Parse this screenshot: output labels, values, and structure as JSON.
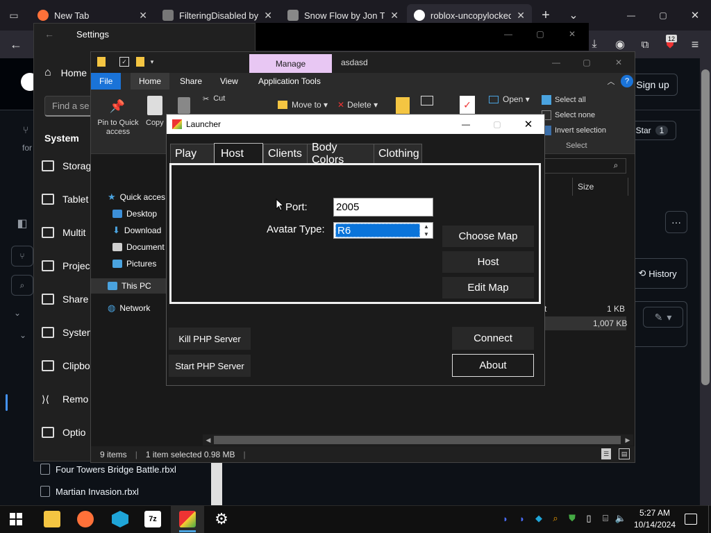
{
  "browser": {
    "tabs": [
      {
        "title": "New Tab",
        "color": "#ff7139"
      },
      {
        "title": "FilteringDisabled by be",
        "color": "#777777"
      },
      {
        "title": "Snow Flow by Jon Topi",
        "color": "#888888"
      },
      {
        "title": "roblox-uncopylocked-",
        "color": "#ffffff"
      }
    ],
    "new_tab": "+",
    "tab_list": "⌄",
    "minimize": "—",
    "maximize": "▢",
    "close": "✕",
    "notification_count": "12"
  },
  "settings": {
    "title": "Settings",
    "back": "←",
    "home": "Home",
    "search_placeholder": "Find a se",
    "section": "System",
    "items": [
      "Storag",
      "Tablet",
      "Multit",
      "Projec",
      "Share",
      "Systen",
      "Clipbo",
      "Remo",
      "Optio"
    ]
  },
  "github": {
    "sign_up": "Sign up",
    "star": "Star",
    "star_count": "1",
    "history": "History",
    "more": "···",
    "col_size": "Size",
    "file_size_1": "1 KB",
    "file_size_2": "1,007 KB",
    "file_frag": "t",
    "fork_frag": "for",
    "files_below": [
      "Four Towers Bridge Battle.rbxl",
      "Martian Invasion.rbxl"
    ]
  },
  "explorer": {
    "manage": "Manage",
    "window_title": "asdasd",
    "ribbon_tabs": [
      "File",
      "Home",
      "Share",
      "View",
      "Application Tools"
    ],
    "ribbon": {
      "pin": "Pin to Quick access",
      "copy": "Copy",
      "cut": "Cut",
      "move_to": "Move to ▾",
      "delete": "Delete ▾",
      "open": "Open ▾",
      "select_all": "Select all",
      "select_none": "Select none",
      "invert": "Invert selection",
      "select_group": "Select"
    },
    "nav": [
      "Quick acces",
      "Desktop",
      "Download",
      "Document",
      "Pictures",
      "This PC",
      "Network"
    ],
    "nav_colors": [
      "#4aa3df",
      "#3c8fd8",
      "#4aa3df",
      "#cfcfcf",
      "#4aa3df",
      "#4aa3df",
      "#4aa3df"
    ],
    "status": [
      "9 items",
      "1 item selected  0.98 MB"
    ]
  },
  "launcher": {
    "title": "Launcher",
    "tabs": [
      "Play",
      "Host",
      "Clients",
      "Body Colors",
      "Clothing"
    ],
    "port_label": "Port:",
    "port_value": "2005",
    "avatar_label": "Avatar Type:",
    "avatar_value": "R6",
    "choose_map": "Choose Map",
    "host": "Host",
    "edit_map": "Edit Map",
    "kill_php": "Kill PHP Server",
    "start_php": "Start PHP Server",
    "connect": "Connect",
    "about": "About"
  },
  "taskbar": {
    "time": "5:27 AM",
    "date": "10/14/2024"
  }
}
